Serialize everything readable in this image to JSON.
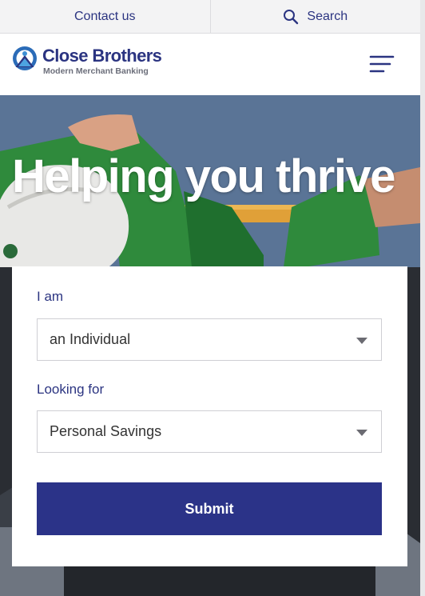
{
  "utility_bar": {
    "contact_label": "Contact us",
    "search_label": "Search"
  },
  "brand": {
    "name": "Close Brothers",
    "tagline": "Modern Merchant Banking",
    "primary_color": "#2b3481",
    "accent_color": "#3d8fd4"
  },
  "hero": {
    "title": "Helping you thrive"
  },
  "form": {
    "i_am_label": "I am",
    "i_am_value": "an Individual",
    "looking_for_label": "Looking for",
    "looking_for_value": "Personal Savings",
    "submit_label": "Submit"
  },
  "icons": {
    "search": "search-icon",
    "menu": "hamburger-menu-icon",
    "dropdown": "chevron-down-icon"
  }
}
